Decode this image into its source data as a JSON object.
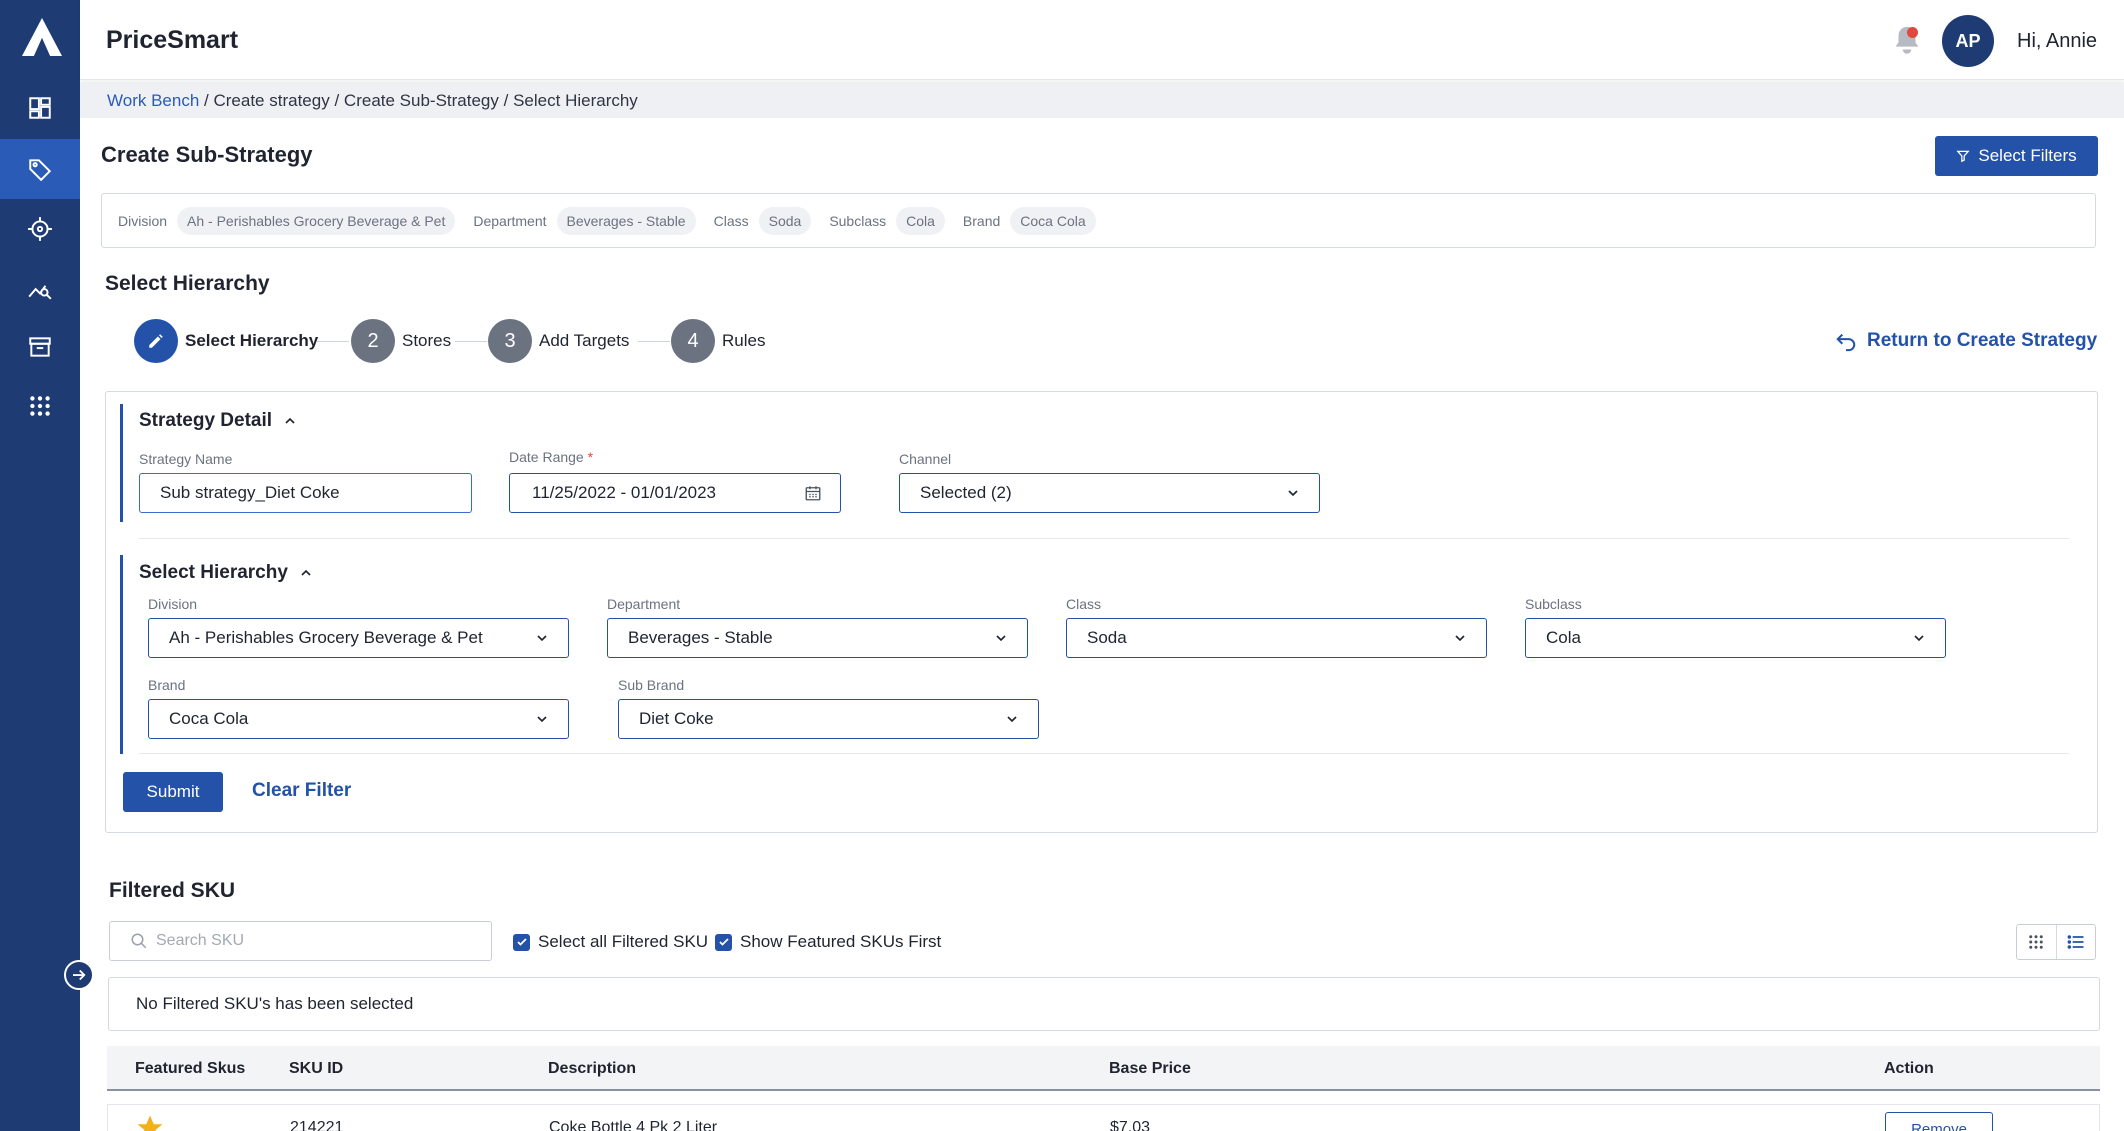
{
  "app": {
    "title": "PriceSmart"
  },
  "sidebar": {
    "items": [
      {
        "name": "dashboard-icon",
        "active": false
      },
      {
        "name": "tag-icon",
        "active": true
      },
      {
        "name": "crosshair-icon",
        "active": false
      },
      {
        "name": "analytics-search-icon",
        "active": false
      },
      {
        "name": "archive-icon",
        "active": false
      },
      {
        "name": "apps-grid-icon",
        "active": false
      }
    ]
  },
  "header": {
    "avatar_initials": "AP",
    "greeting": "Hi, Annie"
  },
  "breadcrumb": {
    "items": [
      "Work Bench",
      "Create strategy",
      "Create Sub-Strategy",
      "Select Hierarchy"
    ],
    "separator": "/"
  },
  "page": {
    "title": "Create Sub-Strategy",
    "select_filters_label": "Select Filters"
  },
  "filters": [
    {
      "label": "Division",
      "value": "Ah - Perishables Grocery Beverage & Pet"
    },
    {
      "label": "Department",
      "value": "Beverages - Stable"
    },
    {
      "label": "Class",
      "value": "Soda"
    },
    {
      "label": "Subclass",
      "value": "Cola"
    },
    {
      "label": "Brand",
      "value": "Coca Cola"
    }
  ],
  "stepper": {
    "title": "Select Hierarchy",
    "steps": [
      {
        "number": "1",
        "label": "Select Hierarchy"
      },
      {
        "number": "2",
        "label": "Stores"
      },
      {
        "number": "3",
        "label": "Add Targets"
      },
      {
        "number": "4",
        "label": "Rules"
      }
    ],
    "return_label": "Return to Create Strategy"
  },
  "strategy_detail": {
    "title": "Strategy Detail",
    "name_label": "Strategy Name",
    "name_value": "Sub strategy_Diet Coke",
    "date_label": "Date Range",
    "date_required": "*",
    "date_value": "11/25/2022 - 01/01/2023",
    "channel_label": "Channel",
    "channel_value": "Selected (2)"
  },
  "hierarchy": {
    "title": "Select Hierarchy",
    "division_label": "Division",
    "division_value": "Ah - Perishables Grocery Beverage & Pet",
    "department_label": "Department",
    "department_value": "Beverages - Stable",
    "class_label": "Class",
    "class_value": "Soda",
    "subclass_label": "Subclass",
    "subclass_value": "Cola",
    "brand_label": "Brand",
    "brand_value": "Coca Cola",
    "subbrand_label": "Sub Brand",
    "subbrand_value": "Diet Coke"
  },
  "actions": {
    "submit_label": "Submit",
    "clear_label": "Clear Filter"
  },
  "filtered_sku": {
    "title": "Filtered SKU",
    "search_placeholder": "Search SKU",
    "select_all_label": "Select all Filtered SKU",
    "featured_first_label": "Show Featured SKUs First",
    "empty_message": "No Filtered SKU's has been selected"
  },
  "table": {
    "columns": [
      "Featured Skus",
      "SKU ID",
      "Description",
      "Base Price",
      "Action"
    ],
    "rows": [
      {
        "sku_id": "214221",
        "description": "Coke Bottle 4 Pk 2 Liter",
        "base_price": "$7.03",
        "action": "Remove"
      }
    ]
  },
  "colors": {
    "sidebar": "#1e3b73",
    "sidebar_active": "#2a5bb7",
    "primary": "#2352a8",
    "alert": "#e0483c",
    "star": "#f2b01e"
  }
}
